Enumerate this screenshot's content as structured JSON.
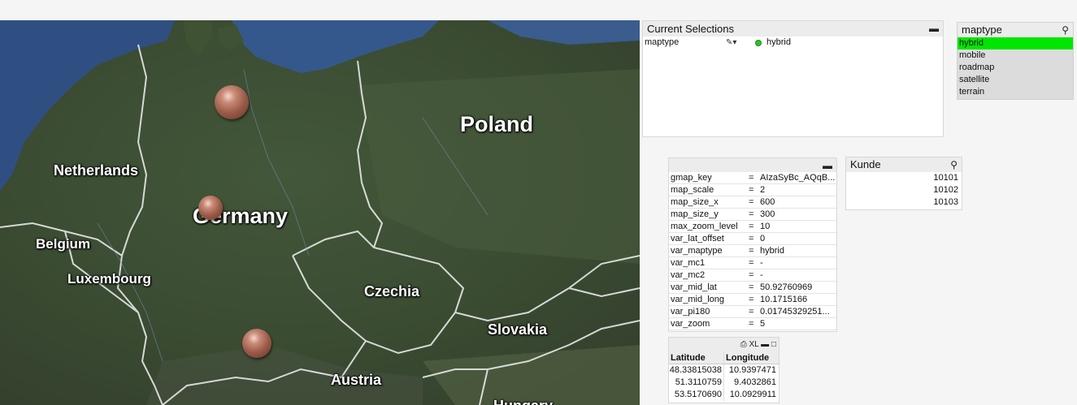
{
  "map": {
    "labels": {
      "poland": "Poland",
      "netherlands": "Netherlands",
      "germany": "Germany",
      "belgium": "Belgium",
      "luxembourg": "Luxembourg",
      "czechia": "Czechia",
      "slovakia": "Slovakia",
      "austria": "Austria",
      "hungary": "Hungary"
    },
    "colors": {
      "land": "#3b4a33",
      "water": "#3a5c8e",
      "border": "#e8e8e8",
      "marker": "#9a5a48"
    }
  },
  "current_selections": {
    "title": "Current Selections",
    "minimize_icon": "minimize-icon",
    "rows": [
      {
        "field": "maptype",
        "value": "hybrid",
        "status_color": "#2fbf2f"
      }
    ]
  },
  "maptype_list": {
    "title": "maptype",
    "search_icon": "search-icon",
    "items": [
      "hybrid",
      "mobile",
      "roadmap",
      "satellite",
      "terrain"
    ],
    "selected": "hybrid",
    "selected_color": "#00e600"
  },
  "variables": {
    "rows": [
      {
        "name": "gmap_key",
        "eq": "=",
        "value": "AIzaSyBc_AQqB..."
      },
      {
        "name": "map_scale",
        "eq": "=",
        "value": "2"
      },
      {
        "name": "map_size_x",
        "eq": "=",
        "value": "600"
      },
      {
        "name": "map_size_y",
        "eq": "=",
        "value": "300"
      },
      {
        "name": "max_zoom_level",
        "eq": "=",
        "value": "10"
      },
      {
        "name": "var_lat_offset",
        "eq": "=",
        "value": "0"
      },
      {
        "name": "var_maptype",
        "eq": "=",
        "value": "hybrid"
      },
      {
        "name": "var_mc1",
        "eq": "=",
        "value": "-"
      },
      {
        "name": "var_mc2",
        "eq": "=",
        "value": "-"
      },
      {
        "name": "var_mid_lat",
        "eq": "=",
        "value": "50.92760969"
      },
      {
        "name": "var_mid_long",
        "eq": "=",
        "value": "10.1715166"
      },
      {
        "name": "var_pi180",
        "eq": "=",
        "value": "0.01745329251..."
      },
      {
        "name": "var_zoom",
        "eq": "=",
        "value": "5"
      }
    ]
  },
  "kunde_list": {
    "title": "Kunde",
    "items": [
      "10101",
      "10102",
      "10103"
    ]
  },
  "coord_table": {
    "xl_label": "XL",
    "headers": {
      "lat": "Latitude",
      "long": "Longitude"
    },
    "rows": [
      {
        "lat": "48.33815038",
        "long": "10.9397471"
      },
      {
        "lat": "51.3110759",
        "long": "9.4032861"
      },
      {
        "lat": "53.5170690",
        "long": "10.0929911"
      }
    ]
  }
}
